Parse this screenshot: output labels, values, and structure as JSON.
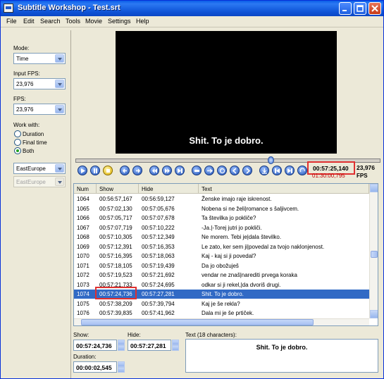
{
  "window": {
    "title": "Subtitle Workshop - Test.srt"
  },
  "menu": [
    "File",
    "Edit",
    "Search",
    "Tools",
    "Movie",
    "Settings",
    "Help"
  ],
  "left_panel": {
    "mode_label": "Mode:",
    "mode_value": "Time",
    "input_fps_label": "Input FPS:",
    "input_fps_value": "23,976",
    "fps_label": "FPS:",
    "fps_value": "23,976",
    "work_with_label": "Work with:",
    "work_with_options": [
      "Duration",
      "Final time",
      "Both"
    ],
    "work_with_selected": "Both",
    "encoding_value": "EastEurope",
    "encoding2_value": "EastEurope"
  },
  "video": {
    "subtitle": "Shit. To je dobro."
  },
  "player": {
    "current_time": "00:57:25,140",
    "total_time": "01:30:00,795",
    "fps_value": "23,976",
    "fps_label": "FPS",
    "position_fraction": 0.64
  },
  "list": {
    "columns": [
      "Num",
      "Show",
      "Hide",
      "Text"
    ],
    "rows": [
      [
        "1064",
        "00:56:57,167",
        "00:56:59,127",
        "Ženske imajo raje iskrenost."
      ],
      [
        "1065",
        "00:57:02,130",
        "00:57:05,676",
        "Nobena si ne želi|romance s šaljivcem."
      ],
      [
        "1066",
        "00:57:05,717",
        "00:57:07,678",
        "Ta številka jo pokliče?"
      ],
      [
        "1067",
        "00:57:07,719",
        "00:57:10,222",
        "-Ja.|-Torej jutri jo pokliči."
      ],
      [
        "1068",
        "00:57:10,305",
        "00:57:12,349",
        "Ne morem. Tebi je|dala številko."
      ],
      [
        "1069",
        "00:57:12,391",
        "00:57:16,353",
        "Le zato, ker sem ji|povedal za tvojo naklonjenost."
      ],
      [
        "1070",
        "00:57:16,395",
        "00:57:18,063",
        "Kaj - kaj si ji povedal?"
      ],
      [
        "1071",
        "00:57:18,105",
        "00:57:19,439",
        "Da jo obožuješ"
      ],
      [
        "1072",
        "00:57:19,523",
        "00:57:21,692",
        "vendar ne znaš|narediti prvega koraka"
      ],
      [
        "1073",
        "00:57:21,733",
        "00:57:24,695",
        "odkar si ji rekel,|da dvoriš drugi."
      ],
      [
        "1074",
        "00:57:24,736",
        "00:57:27,281",
        "Shit. To je dobro."
      ],
      [
        "1075",
        "00:57:38,209",
        "00:57:39,794",
        "Kaj je še rekla?"
      ],
      [
        "1076",
        "00:57:39,835",
        "00:57:41,962",
        "Dala mi je še prtiček."
      ]
    ],
    "selected_num": "1074"
  },
  "bottom": {
    "show_label": "Show:",
    "show_value": "00:57:24,736",
    "hide_label": "Hide:",
    "hide_value": "00:57:27,281",
    "duration_label": "Duration:",
    "duration_value": "00:00:02,545",
    "text_label": "Text (18 characters):",
    "text_value": "Shit. To je dobro."
  },
  "colors": {
    "selection": "#316ac5",
    "highlight_box": "#e03030",
    "title_bar": "#0a5ee8"
  }
}
